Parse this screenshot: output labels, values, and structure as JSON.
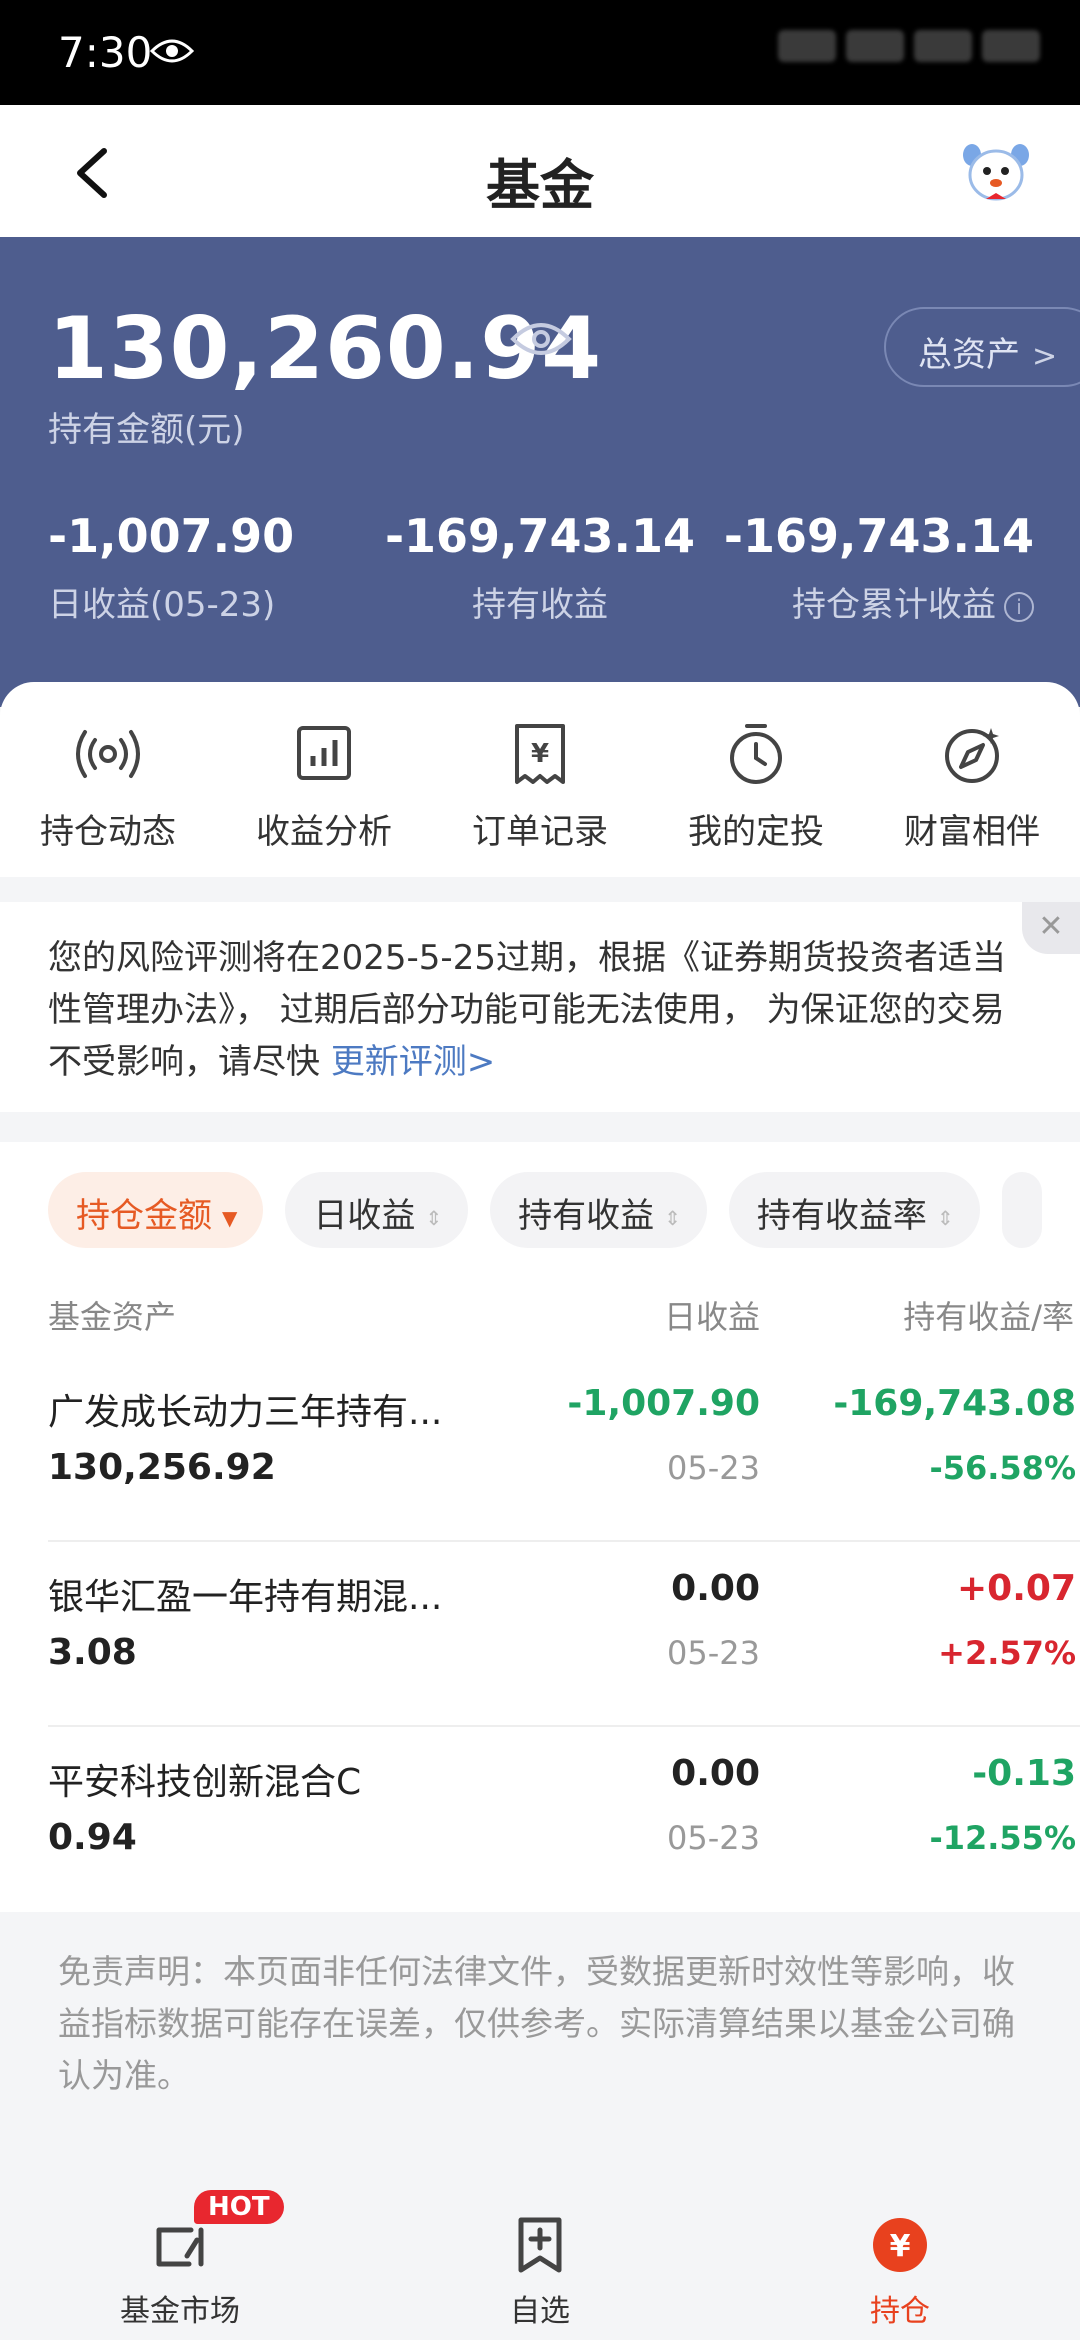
{
  "status_bar": {
    "time": "7:30"
  },
  "nav": {
    "title": "基金"
  },
  "summary": {
    "total_amount": "130,260.94",
    "amount_label": "持有金额(元)",
    "total_assets_btn": "总资产",
    "daily_income": "-1,007.90",
    "daily_income_label": "日收益(05-23)",
    "holding_income": "-169,743.14",
    "holding_income_label": "持有收益",
    "cumulative_income": "-169,743.14",
    "cumulative_income_label": "持仓累计收益"
  },
  "quick_menu": [
    {
      "label": "持仓动态",
      "icon": "broadcast-icon"
    },
    {
      "label": "收益分析",
      "icon": "bar-chart-icon"
    },
    {
      "label": "订单记录",
      "icon": "receipt-icon"
    },
    {
      "label": "我的定投",
      "icon": "stopwatch-icon"
    },
    {
      "label": "财富相伴",
      "icon": "compass-icon"
    }
  ],
  "notice": {
    "text": "您的风险评测将在2025-5-25过期，根据《证券期货投资者适当性管理办法》， 过期后部分功能可能无法使用， 为保证您的交易不受影响，请尽快 ",
    "link": "更新评测>"
  },
  "sort_chips": [
    "持仓金额",
    "日收益",
    "持有收益",
    "持有收益率"
  ],
  "table": {
    "headers": [
      "基金资产",
      "日收益",
      "持有收益/率"
    ],
    "rows": [
      {
        "name": "广发成长动力三年持有...",
        "amount": "130,256.92",
        "daily": "-1,007.90",
        "date": "05-23",
        "hold": "-169,743.08",
        "rate": "-56.58%"
      },
      {
        "name": "银华汇盈一年持有期混...",
        "amount": "3.08",
        "daily": "0.00",
        "date": "05-23",
        "hold": "+0.07",
        "rate": "+2.57%"
      },
      {
        "name": "平安科技创新混合C",
        "amount": "0.94",
        "daily": "0.00",
        "date": "05-23",
        "hold": "-0.13",
        "rate": "-12.55%"
      }
    ]
  },
  "disclaimer": "免责声明：本页面非任何法律文件，受数据更新时效性等影响，收益指标数据可能存在误差，仅供参考。实际清算结果以基金公司确认为准。",
  "tabbar": {
    "items": [
      {
        "label": "基金市场",
        "icon": "market-icon"
      },
      {
        "label": "自选",
        "icon": "bookmark-add-icon"
      },
      {
        "label": "持仓",
        "icon": "yuan-coin-icon"
      }
    ],
    "badge": "HOT",
    "active_index": 2
  },
  "colors": {
    "header_bg": "#4e5d8e",
    "gain": "#d8262f",
    "loss": "#1fa463",
    "accent": "#e65a24"
  }
}
